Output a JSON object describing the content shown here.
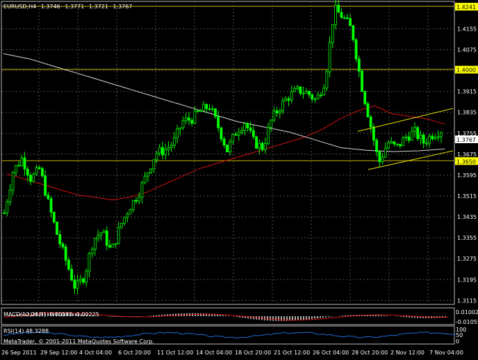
{
  "symbol_header": {
    "symbol": "EURUSD,H4",
    "open": "1.3746",
    "high": "1.3771",
    "low": "1.3721",
    "close": "1.3767"
  },
  "colors": {
    "background": "#000000",
    "grid": "#4a4a4a",
    "bull_candle": "#00ff00",
    "bear_candle": "#00ff00",
    "ma_fast": "#d01010",
    "ma_slow": "#d8d8d8",
    "level_line": "#c8b400",
    "channel_line": "#e8e800",
    "price_box_bg": "#ffffff",
    "level_box_bg": "#ffff00",
    "macd_hist": "#ffffff",
    "macd_signal": "#d01010",
    "rsi_line": "#1e6ed8",
    "text": "#ffffff"
  },
  "price_axis": {
    "labels": [
      "1.4241",
      "1.4155",
      "1.4075",
      "1.3995",
      "1.3915",
      "1.3835",
      "1.3755",
      "1.3675",
      "1.3595",
      "1.3515",
      "1.3435",
      "1.3355",
      "1.3275",
      "1.3195",
      "1.3115"
    ],
    "current_price": "1.3767",
    "range": [
      1.31,
      1.426
    ]
  },
  "horizontal_levels": [
    {
      "label": "1.4241",
      "value": 1.4241
    },
    {
      "label": "1.4000",
      "value": 1.4
    },
    {
      "label": "1.3650",
      "value": 1.365
    }
  ],
  "time_axis": {
    "labels": [
      "26 Sep 2011",
      "29 Sep 12:00",
      "4 Oct 04:00",
      "6 Oct 20:00",
      "11 Oct 12:00",
      "14 Oct 04:00",
      "18 Oct 20:00",
      "21 Oct 12:00",
      "26 Oct 04:00",
      "28 Oct 20:00",
      "2 Nov 12:00",
      "7 Nov 04:00"
    ]
  },
  "macd": {
    "label": "MACD(12,26,9) -0.00103 -0.00225",
    "axis_top": "0.01002",
    "axis_bottom": "-0.01055"
  },
  "rsi": {
    "label": "RSI(14) 48.3288",
    "axis_top": "100",
    "axis_mid": "50",
    "axis_bottom": "0"
  },
  "copyright": "MetaTrader, © 2001-2011 MetaQuotes Software Corp.",
  "chart_data": {
    "type": "candlestick",
    "symbol": "EURUSD",
    "timeframe": "H4",
    "ylim": [
      1.31,
      1.426
    ],
    "close_path": [
      1.345,
      1.361,
      1.366,
      1.358,
      1.362,
      1.348,
      1.336,
      1.326,
      1.316,
      1.321,
      1.335,
      1.338,
      1.33,
      1.34,
      1.347,
      1.352,
      1.36,
      1.368,
      1.369,
      1.372,
      1.38,
      1.381,
      1.384,
      1.386,
      1.378,
      1.369,
      1.376,
      1.38,
      1.372,
      1.37,
      1.381,
      1.386,
      1.39,
      1.392,
      1.391,
      1.388,
      1.396,
      1.423,
      1.42,
      1.415,
      1.395,
      1.38,
      1.364,
      1.372,
      1.37,
      1.374,
      1.376,
      1.372,
      1.375,
      1.3767
    ],
    "ma_fast": [
      1.36,
      1.358,
      1.356,
      1.354,
      1.352,
      1.351,
      1.35,
      1.351,
      1.353,
      1.356,
      1.359,
      1.362,
      1.364,
      1.366,
      1.368,
      1.37,
      1.372,
      1.374,
      1.377,
      1.381,
      1.384,
      1.386,
      1.383,
      1.382,
      1.381,
      1.379
    ],
    "ma_slow": [
      1.406,
      1.404,
      1.401,
      1.398,
      1.395,
      1.392,
      1.389,
      1.386,
      1.383,
      1.38,
      1.378,
      1.376,
      1.373,
      1.37,
      1.369,
      1.3685,
      1.3688,
      1.3695
    ],
    "levels": [
      1.4241,
      1.4,
      1.365
    ],
    "current": 1.3767
  }
}
